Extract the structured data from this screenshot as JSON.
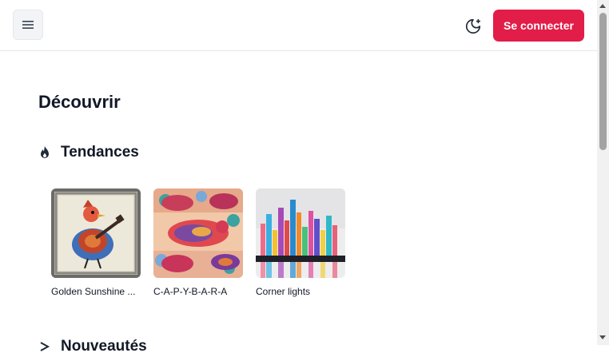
{
  "header": {
    "menu_icon": "hamburger-icon",
    "theme_icon": "moon-stars-icon",
    "login_label": "Se connecter",
    "accent_color": "#e11d48"
  },
  "main": {
    "title": "Découvrir",
    "trending": {
      "icon": "flame-icon",
      "title": "Tendances",
      "items": [
        {
          "label": "Golden Sunshine ..."
        },
        {
          "label": "C-A-P-Y-B-A-R-A"
        },
        {
          "label": "Corner lights"
        }
      ]
    },
    "next_section": {
      "icon": "chevron-icon",
      "title": "Nouveautés"
    }
  }
}
